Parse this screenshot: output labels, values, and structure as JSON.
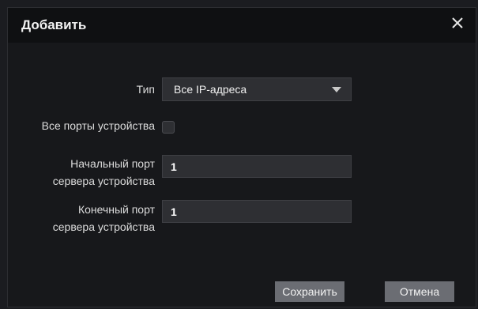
{
  "dialog": {
    "title": "Добавить",
    "close_icon": "close-icon"
  },
  "form": {
    "type_label": "Тип",
    "type_value": "Все IP-адреса",
    "all_ports_label": "Все порты устройства",
    "all_ports_checked": false,
    "start_port_label_line1": "Начальный порт",
    "start_port_label_line2": "сервера устройства",
    "start_port_value": "1",
    "end_port_label_line1": "Конечный порт",
    "end_port_label_line2": "сервера устройства",
    "end_port_value": "1"
  },
  "buttons": {
    "save_label": "Сохранить",
    "cancel_label": "Отмена"
  }
}
